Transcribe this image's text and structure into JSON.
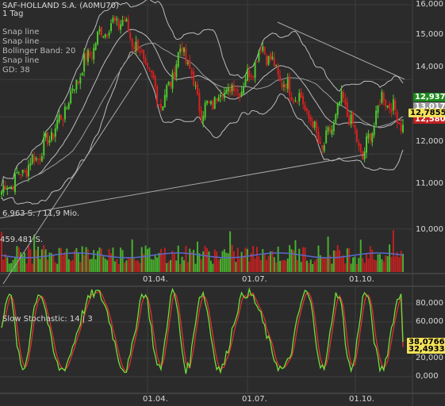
{
  "header": {
    "title": "SAF-HOLLAND S.A. (A0MU70)",
    "interval": "1 Tag",
    "studies": [
      "Snap line",
      "Snap line",
      "Bollinger Band: 20",
      "Snap line",
      "GD: 38"
    ]
  },
  "price_axis": {
    "ticks": [
      "16,000",
      "15,000",
      "14,000",
      "13,000",
      "12,000",
      "11,000",
      "10,000"
    ]
  },
  "volume_axis_label": "10,000",
  "stoch_axis": {
    "ticks": [
      "80,000",
      "60,000",
      "40,000",
      "20,000",
      "0,000"
    ]
  },
  "date_ticks": [
    "01.04.",
    "01.07.",
    "01.10."
  ],
  "volume_labels": [
    "6.963 S. / 11,9 Mio.",
    "459.481 S."
  ],
  "stoch_label": "Slow Stochastic: 14 | 3",
  "price_tags": [
    {
      "text": "12,937",
      "bg": "#1e8a1e",
      "fg": "#ffffff"
    },
    {
      "text": "13,017",
      "bg": "#9a9a9a",
      "fg": "#ffffff"
    },
    {
      "text": "12,78559",
      "bg": "#f2e25a",
      "fg": "#000000"
    },
    {
      "text": "12,580",
      "bg": "#c62020",
      "fg": "#ffffff"
    }
  ],
  "stoch_tags": [
    {
      "text": "38,07664",
      "bg": "#f2e25a",
      "fg": "#000000"
    },
    {
      "text": "32,49330",
      "bg": "#f2e25a",
      "fg": "#000000"
    }
  ],
  "colors": {
    "up": "#4ec82e",
    "down": "#d92020",
    "band": "#bcbcbc",
    "stoch_k": "#6ee03a",
    "stoch_d": "#e03030",
    "grid": "#3c3c3c"
  },
  "chart_data": {
    "type": "line",
    "title": "SAF-HOLLAND S.A. (A0MU70)",
    "ylim": [
      9700,
      16050
    ],
    "close_anchors": [
      {
        "x": "01.01.",
        "y": 11000
      },
      {
        "x": "15.01.",
        "y": 11500
      },
      {
        "x": "01.02.",
        "y": 12100
      },
      {
        "x": "15.02.",
        "y": 13000
      },
      {
        "x": "01.03.",
        "y": 14300
      },
      {
        "x": "15.03.",
        "y": 15300
      },
      {
        "x": "01.04.",
        "y": 15600
      },
      {
        "x": "15.04.",
        "y": 14600
      },
      {
        "x": "01.05.",
        "y": 13300
      },
      {
        "x": "15.05.",
        "y": 14900
      },
      {
        "x": "01.06.",
        "y": 13100
      },
      {
        "x": "15.06.",
        "y": 13700
      },
      {
        "x": "01.07.",
        "y": 13800
      },
      {
        "x": "15.07.",
        "y": 14900
      },
      {
        "x": "01.08.",
        "y": 13900
      },
      {
        "x": "15.08.",
        "y": 13400
      },
      {
        "x": "01.09.",
        "y": 12100
      },
      {
        "x": "15.09.",
        "y": 13500
      },
      {
        "x": "01.10.",
        "y": 11900
      },
      {
        "x": "15.10.",
        "y": 13600
      },
      {
        "x": "01.11.",
        "y": 12785
      }
    ],
    "stochastic": {
      "name": "Slow Stochastic: 14 | 3",
      "k_last": 38.07664,
      "d_last": 32.4933,
      "ylim": [
        -10,
        100
      ]
    }
  }
}
